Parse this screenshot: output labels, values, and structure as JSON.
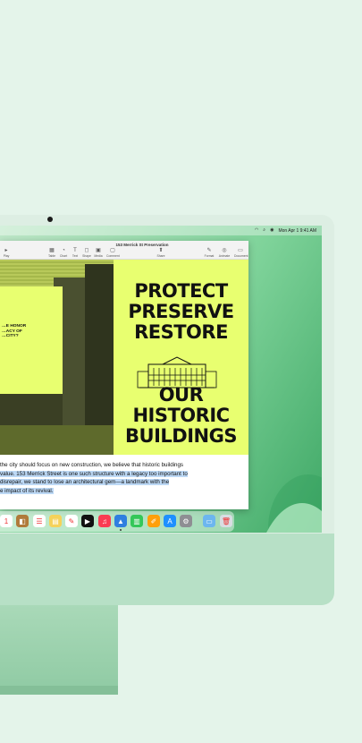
{
  "menubar": {
    "clock": "Mon Apr 1  9:41 AM"
  },
  "window": {
    "title": "153 Merrick St Preservation",
    "toolbar": {
      "left_label": "Play",
      "buttons": [
        "Table",
        "Chart",
        "Text",
        "Shape",
        "Media",
        "Comment"
      ],
      "share_label": "Share",
      "right_buttons": [
        "Format",
        "Animate",
        "Document"
      ]
    }
  },
  "poster": {
    "photo_text": "…E HONOR\n…ACY OF\n…CITY?",
    "headline_top": [
      "PROTECT",
      "PRESERVE",
      "RESTORE"
    ],
    "headline_bottom": [
      "OUR",
      "HISTORIC",
      "BUILDINGS"
    ]
  },
  "body_text": {
    "line1": " the city should focus on new construction, we believe that historic buildings",
    "line2": " value. 153 Merrick Street is one such structure with a legacy too important to",
    "line3": "disrepair, we stand to lose an architectural gem—a landmark with the",
    "line4": "e impact of its revival."
  },
  "dock": {
    "apps": [
      {
        "name": "calendar",
        "color": "#ffffff",
        "glyph": "1"
      },
      {
        "name": "contacts",
        "color": "#b07a3a",
        "glyph": "◧"
      },
      {
        "name": "reminders",
        "color": "#ffffff",
        "glyph": "☰"
      },
      {
        "name": "notes",
        "color": "#f5d25a",
        "glyph": "▤"
      },
      {
        "name": "freeform",
        "color": "#ffffff",
        "glyph": "✎"
      },
      {
        "name": "tv",
        "color": "#111111",
        "glyph": "▶"
      },
      {
        "name": "music",
        "color": "#fa3b52",
        "glyph": "♫"
      },
      {
        "name": "keynote",
        "color": "#2f7fe0",
        "glyph": "▲"
      },
      {
        "name": "numbers",
        "color": "#34c759",
        "glyph": "▥"
      },
      {
        "name": "pages",
        "color": "#ff9f0a",
        "glyph": "✐"
      },
      {
        "name": "app-store",
        "color": "#1e90ff",
        "glyph": "A"
      },
      {
        "name": "system-settings",
        "color": "#8e8e93",
        "glyph": "⚙"
      },
      {
        "name": "downloads-folder",
        "color": "#6cb6ef",
        "glyph": "▭"
      },
      {
        "name": "trash",
        "color": "#d8dde2",
        "glyph": "🗑"
      }
    ]
  },
  "colors": {
    "poster_background": "#e8ff70",
    "selection_highlight": "#bcd8f5",
    "wallpaper": "#7fd39a"
  }
}
